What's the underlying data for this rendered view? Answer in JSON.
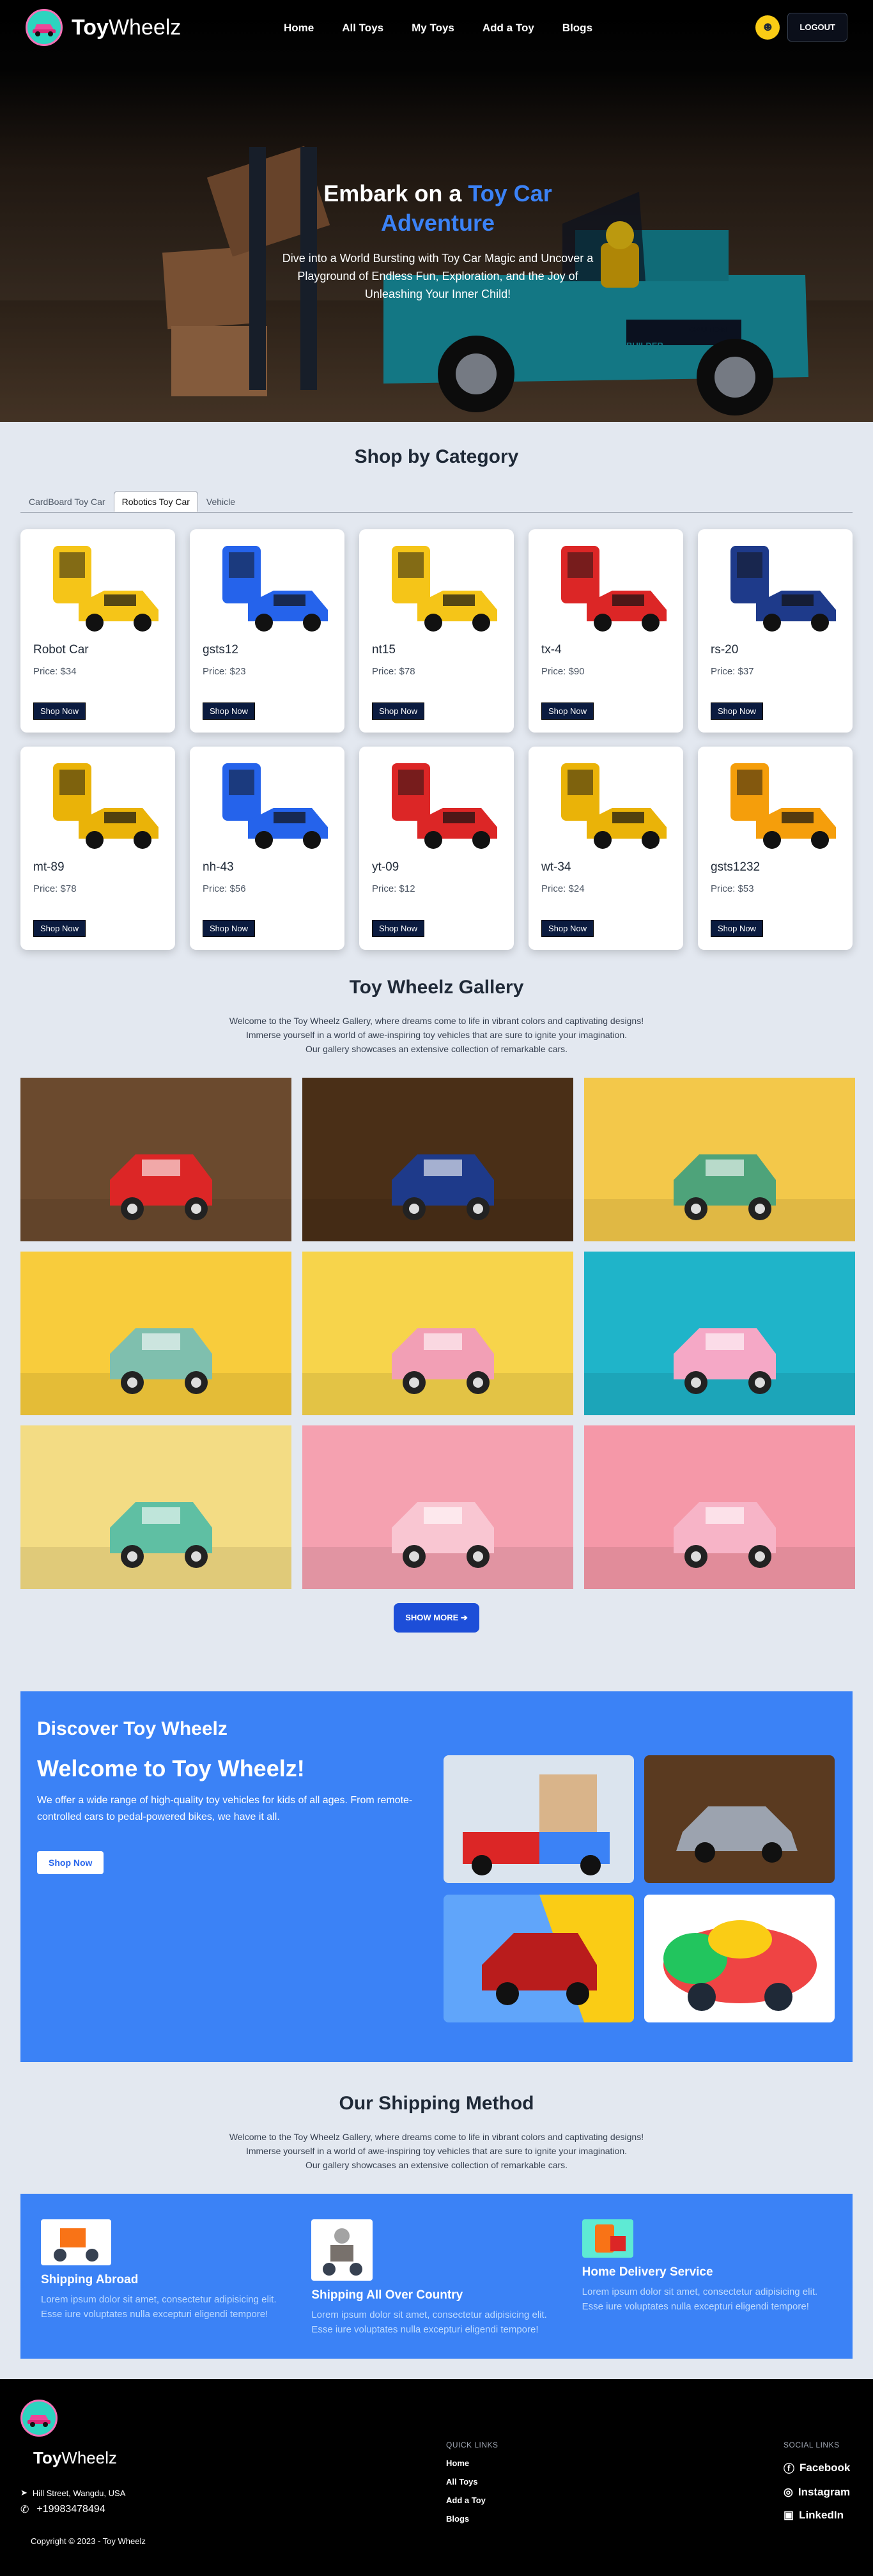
{
  "nav": {
    "brand": "ToyWheelz",
    "brand_bold": "Toy",
    "brand_rest": "Wheelz",
    "links": [
      "Home",
      "All Toys",
      "My Toys",
      "Add a Toy",
      "Blogs"
    ],
    "logout": "LOGOUT"
  },
  "hero": {
    "title_a": "Embark on a ",
    "title_hl": "Toy Car Adventure",
    "desc": "Dive into a World Bursting with Toy Car Magic and Uncover a Playground of Endless Fun, Exploration, and the Joy of Unleashing Your Inner Child!",
    "truck_text_1": "CAUTION",
    "truck_text_2": "BUILDER"
  },
  "category": {
    "title": "Shop by Category",
    "tabs": [
      "CardBoard Toy Car",
      "Robotics Toy Car",
      "Vehicle"
    ],
    "active_tab": "Robotics Toy Car",
    "button_label": "Shop Now",
    "products": [
      {
        "name": "Robot Car",
        "price": "Price: $34",
        "color": "#f5c518"
      },
      {
        "name": "gsts12",
        "price": "Price: $23",
        "color": "#2563eb"
      },
      {
        "name": "nt15",
        "price": "Price: $78",
        "color": "#f5c518"
      },
      {
        "name": "tx-4",
        "price": "Price: $90",
        "color": "#dc2626"
      },
      {
        "name": "rs-20",
        "price": "Price: $37",
        "color": "#1e3a8a"
      },
      {
        "name": "mt-89",
        "price": "Price: $78",
        "color": "#eab308"
      },
      {
        "name": "nh-43",
        "price": "Price: $56",
        "color": "#2563eb"
      },
      {
        "name": "yt-09",
        "price": "Price: $12",
        "color": "#dc2626"
      },
      {
        "name": "wt-34",
        "price": "Price: $24",
        "color": "#eab308"
      },
      {
        "name": "gsts1232",
        "price": "Price: $53",
        "color": "#f59e0b"
      }
    ]
  },
  "gallery": {
    "title": "Toy Wheelz Gallery",
    "line1": "Welcome to the Toy Wheelz Gallery, where dreams come to life in vibrant colors and captivating designs!",
    "line2": "Immerse yourself in a world of awe-inspiring toy vehicles that are sure to ignite your imagination.",
    "line3": "Our gallery showcases an extensive collection of remarkable cars.",
    "show_more": "SHOW MORE",
    "items": [
      {
        "name": "red-train",
        "bg": "#6b4a2e",
        "toy": "#dc2626"
      },
      {
        "name": "blue-tuktuk",
        "bg": "#4a2f17",
        "toy": "#1e3a8a"
      },
      {
        "name": "green-truck-egg",
        "bg": "#f3c84a",
        "toy": "#4ea37a"
      },
      {
        "name": "teal-truck-eggs",
        "bg": "#f8cc3c",
        "toy": "#7fbfae"
      },
      {
        "name": "pink-car-egg",
        "bg": "#f7d44b",
        "toy": "#f29fb5"
      },
      {
        "name": "pink-car-nest",
        "bg": "#1fb4c9",
        "toy": "#f5a8c6"
      },
      {
        "name": "teal-hotrod",
        "bg": "#f3dc84",
        "toy": "#5fbfa3"
      },
      {
        "name": "pink-car-bow",
        "bg": "#f5a1b0",
        "toy": "#f9c6d2"
      },
      {
        "name": "pink-car-green-bow",
        "bg": "#f598a8",
        "toy": "#f7b4c7"
      }
    ]
  },
  "discover": {
    "heading": "Discover Toy Wheelz",
    "welcome": "Welcome to Toy Wheelz!",
    "desc": "We offer a wide range of high-quality toy vehicles for kids of all ages. From remote-controlled cars to pedal-powered bikes, we have it all.",
    "button": "Shop Now"
  },
  "shipping": {
    "title": "Our Shipping Method",
    "line1": "Welcome to the Toy Wheelz Gallery, where dreams come to life in vibrant colors and captivating designs!",
    "line2": "Immerse yourself in a world of awe-inspiring toy vehicles that are sure to ignite your imagination.",
    "line3": "Our gallery showcases an extensive collection of remarkable cars.",
    "methods": [
      {
        "title": "Shipping Abroad",
        "text": "Lorem ipsum dolor sit amet, consectetur adipisicing elit. Esse iure voluptates nulla excepturi eligendi tempore!"
      },
      {
        "title": "Shipping All Over Country",
        "text": "Lorem ipsum dolor sit amet, consectetur adipisicing elit. Esse iure voluptates nulla excepturi eligendi tempore!"
      },
      {
        "title": "Home Delivery Service",
        "text": "Lorem ipsum dolor sit amet, consectetur adipisicing elit. Esse iure voluptates nulla excepturi eligendi tempore!"
      }
    ]
  },
  "footer": {
    "brand_bold": "Toy",
    "brand_rest": "Wheelz",
    "address": "Hill Street, Wangdu, USA",
    "phone": "+19983478494",
    "copyright": "Copyright © 2023 - Toy Wheelz",
    "quick_links_title": "QUICK LINKS",
    "quick_links": [
      "Home",
      "All Toys",
      "Add a Toy",
      "Blogs"
    ],
    "social_title": "SOCIAL LINKS",
    "social": [
      "Facebook",
      "Instagram",
      "LinkedIn"
    ]
  }
}
